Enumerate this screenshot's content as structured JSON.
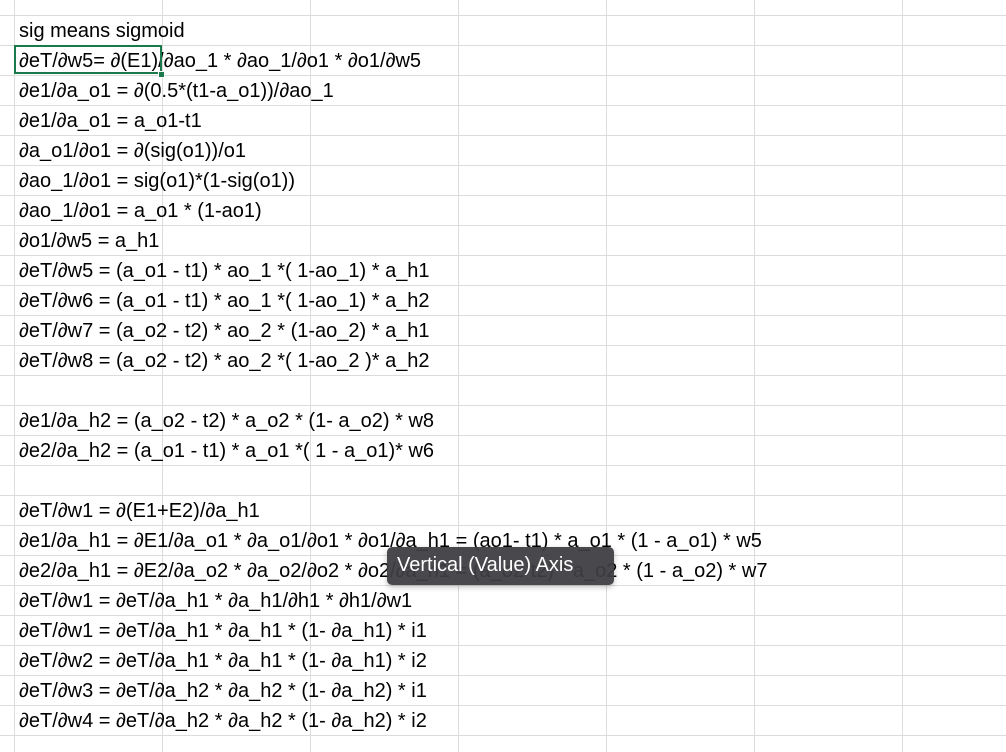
{
  "cells": [
    "sig means sigmoid",
    "∂eT/∂w5= ∂(E1)/∂ao_1 * ∂ao_1/∂o1 * ∂o1/∂w5",
    "∂e1/∂a_o1 = ∂(0.5*(t1-a_o1))/∂ao_1",
    "∂e1/∂a_o1 = a_o1-t1",
    "∂a_o1/∂o1 = ∂(sig(o1))/o1",
    "∂ao_1/∂o1 = sig(o1)*(1-sig(o1))",
    "∂ao_1/∂o1 = a_o1 * (1-ao1)",
    "∂o1/∂w5 = a_h1",
    "∂eT/∂w5 = (a_o1 - t1) * ao_1 *( 1-ao_1) * a_h1",
    "∂eT/∂w6 = (a_o1 - t1) * ao_1 *( 1-ao_1) * a_h2",
    "∂eT/∂w7 = (a_o2 - t2) * ao_2 * (1-ao_2) * a_h1",
    "∂eT/∂w8 = (a_o2 - t2) * ao_2 *( 1-ao_2 )* a_h2",
    "",
    "∂e1/∂a_h2 = (a_o2 - t2) * a_o2 * (1- a_o2) * w8",
    "∂e2/∂a_h2 = (a_o1 - t1) * a_o1 *( 1 - a_o1)* w6",
    "",
    "∂eT/∂w1 = ∂(E1+E2)/∂a_h1",
    "∂e1/∂a_h1 = ∂E1/∂a_o1 * ∂a_o1/∂o1 * ∂o1/∂a_h1 = (ao1- t1) * a_o1 * (1 - a_o1) * w5",
    "∂e2/∂a_h1 = ∂E2/∂a_o2 * ∂a_o2/∂o2 * ∂o2/∂a_h1 = (a_o2-t2) * a_o2 * (1 - a_o2) * w7",
    "∂eT/∂w1 = ∂eT/∂a_h1 * ∂a_h1/∂h1 * ∂h1/∂w1",
    "∂eT/∂w1 = ∂eT/∂a_h1 * ∂a_h1 * (1- ∂a_h1) * i1",
    "∂eT/∂w2 = ∂eT/∂a_h1 * ∂a_h1 * (1- ∂a_h1) * i2",
    "∂eT/∂w3 = ∂eT/∂a_h2 * ∂a_h2 * (1- ∂a_h2) * i1",
    "∂eT/∂w4 = ∂eT/∂a_h2 * ∂a_h2 * (1- ∂a_h2) * i2"
  ],
  "tooltip": {
    "text": "Vertical (Value) Axis"
  },
  "colors": {
    "selection": "#1a7a4c",
    "gridline": "#dcdcdc",
    "tooltip_bg": "#3e3e42"
  }
}
